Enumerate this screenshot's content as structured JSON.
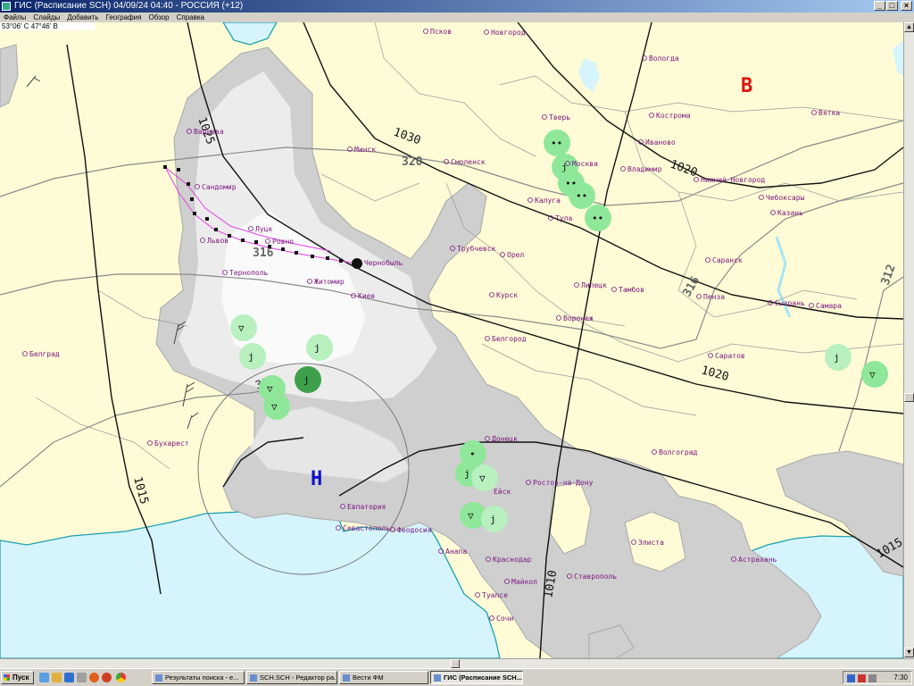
{
  "window": {
    "title": "ГИС (Расписание SCH) 04/09/24 04:40 - РОССИЯ (+12)",
    "minimize": "_",
    "maximize": "□",
    "close": "×"
  },
  "menu": [
    "Файлы",
    "Слайды",
    "Добавить",
    "География",
    "Обзор",
    "Справка"
  ],
  "coords": "53°06' С 47°46' В",
  "map": {
    "pressure_high": "В",
    "pressure_low": "Н",
    "isobar_labels": [
      "1025",
      "1030",
      "1020",
      "1020",
      "1015",
      "1010",
      "1015"
    ],
    "isohypse_labels": [
      "320",
      "316",
      "316",
      "312",
      "312"
    ],
    "cities": [
      "Псков",
      "Новгород",
      "Вологда",
      "Тверь",
      "Кострома",
      "Вятка",
      "Иваново",
      "Москва",
      "Владимир",
      "Нижний Новгород",
      "Чебоксары",
      "Казань",
      "Варшава",
      "Минск",
      "Смоленск",
      "Калуга",
      "Тула",
      "Сандомир",
      "Луцк",
      "Ровно",
      "Львов",
      "Чернобыль",
      "Трубчевск",
      "Орел",
      "Саранск",
      "Тернополь",
      "Житомир",
      "Киев",
      "Курск",
      "Липецк",
      "Тамбов",
      "Пенза",
      "Сызрань",
      "Самара",
      "Воронеж",
      "Белгород",
      "Белград",
      "Саратов",
      "Бухарест",
      "Донецк",
      "Волгоград",
      "Ростов-на-Дону",
      "Ейск",
      "Евпатория",
      "Севастополь",
      "Феодосия",
      "Анапа",
      "Краснодар",
      "Элиста",
      "Астрахань",
      "Ставрополь",
      "Майкоп",
      "Туапсе",
      "Сочи"
    ],
    "colors": {
      "land": "#fffbd6",
      "sea": "#d6f4fc",
      "cloud": "#c8c8c8",
      "precip": "#8fe89a",
      "precip_dark": "#3ea04a",
      "high": "#e01010",
      "low": "#1010c8",
      "track": "#e040e0"
    }
  },
  "taskbar": {
    "start": "Пуск",
    "tasks": [
      "Результаты поиска - e...",
      "SCH.SCH - Редактор ра...",
      "Вести ФМ",
      "ГИС (Расписание SCH..."
    ],
    "clock": "7:30"
  }
}
